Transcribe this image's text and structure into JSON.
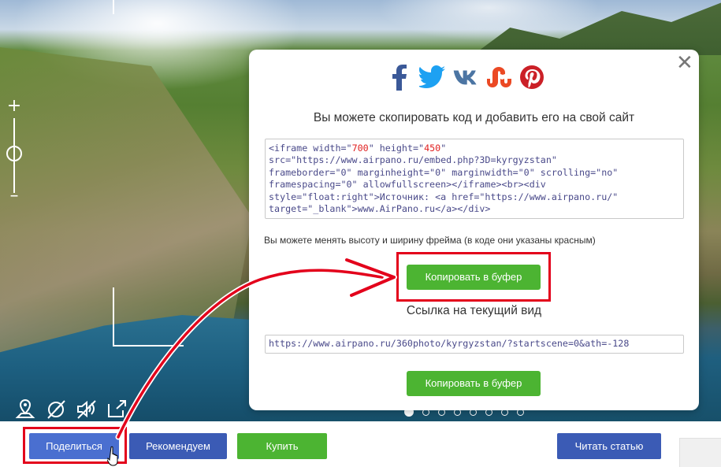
{
  "panorama": {
    "zoom_in_symbol": "+",
    "zoom_out_symbol": "–",
    "tools": [
      {
        "icon": "map-pin-icon"
      },
      {
        "icon": "gyro-off-icon"
      },
      {
        "icon": "sound-off-icon"
      },
      {
        "icon": "fullscreen-icon"
      }
    ],
    "scene_dots": 8,
    "active_dot": 0
  },
  "modal": {
    "close_symbol": "✕",
    "social": [
      "facebook-icon",
      "twitter-icon",
      "vk-icon",
      "stumbleupon-icon",
      "pinterest-icon"
    ],
    "title": "Вы можете скопировать код и добавить его на свой сайт",
    "code_lines": [
      [
        "<iframe width=\"",
        "700",
        "\" height=\"",
        "450",
        "\""
      ],
      [
        "src=\"https://www.airpano.ru/embed.php?3D=kyrgyzstan\""
      ],
      [
        "frameborder=\"0\" marginheight=\"0\" marginwidth=\"0\" scrolling=\"no\""
      ],
      [
        "framespacing=\"0\" allowfullscreen></iframe><br><div"
      ],
      [
        "style=\"float:right\">Источник: <a href=\"https://www.airpano.ru/\""
      ],
      [
        "target=\"_blank\">www.AirPano.ru</a></div>"
      ]
    ],
    "note": "Вы можете менять высоту и ширину фрейма (в коде они указаны красным)",
    "copy_button_label": "Копировать в буфер",
    "link_label": "Ссылка на текущий вид",
    "url_value": "https://www.airpano.ru/360photo/kyrgyzstan/?startscene=0&ath=-128",
    "copy_button2_label": "Копировать в буфер"
  },
  "bottom_bar": {
    "share_label": "Поделиться",
    "recommend_label": "Рекомендуем",
    "buy_label": "Купить",
    "read_label": "Читать статью"
  },
  "colors": {
    "green": "#4cb432",
    "blue": "#3b5bb5",
    "highlight_red": "#e3001b",
    "facebook": "#3b5998",
    "twitter": "#1da1f2",
    "vk": "#4c75a3",
    "stumbleupon": "#eb4924",
    "pinterest": "#cb2027"
  }
}
